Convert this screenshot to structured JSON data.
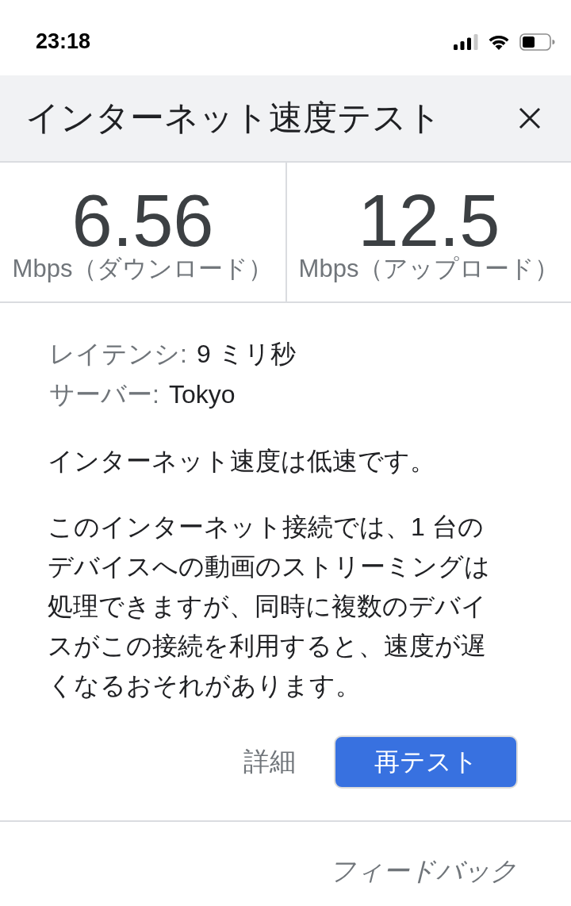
{
  "status_bar": {
    "time": "23:18"
  },
  "header": {
    "title": "インターネット速度テスト"
  },
  "results": [
    {
      "value": "6.56",
      "unit": "Mbps（ダウンロード）"
    },
    {
      "value": "12.5",
      "unit": "Mbps（アップロード）"
    }
  ],
  "details": [
    {
      "label": "レイテンシ:",
      "value": "9 ミリ秒"
    },
    {
      "label": "サーバー:",
      "value": "Tokyo"
    }
  ],
  "summary": "インターネット速度は低速です。",
  "description": "このインターネット接続では、1 台のデバイスへの動画のストリーミングは処理できますが、同時に複数のデバイスがこの接続を利用すると、速度が遅くなるおそれがあります。",
  "actions": {
    "details_link": "詳細",
    "retest_button": "再テスト"
  },
  "footer": {
    "feedback": "フィードバック"
  }
}
